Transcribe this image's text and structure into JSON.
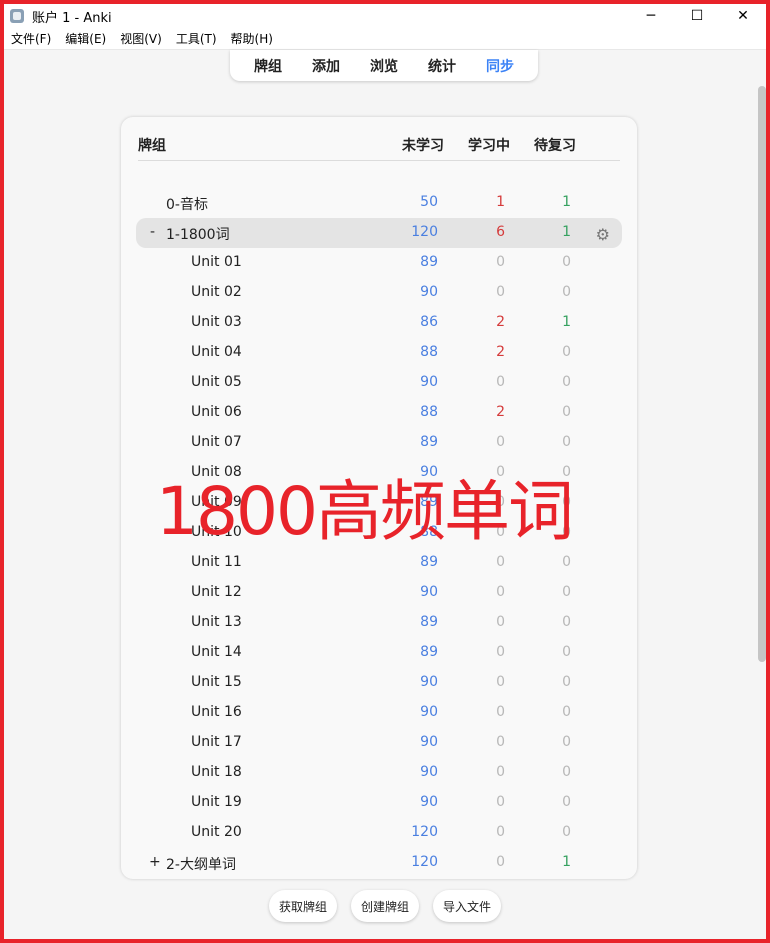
{
  "window": {
    "title": "账户 1 - Anki",
    "minimize": "─",
    "maximize": "☐",
    "close": "✕"
  },
  "menu": [
    "文件(F)",
    "编辑(E)",
    "视图(V)",
    "工具(T)",
    "帮助(H)"
  ],
  "toolbar": {
    "tabs": [
      "牌组",
      "添加",
      "浏览",
      "统计",
      "同步"
    ],
    "active": "同步"
  },
  "table": {
    "headers": {
      "deck": "牌组",
      "new": "未学习",
      "learn": "学习中",
      "review": "待复习"
    },
    "rows": [
      {
        "prefix": "",
        "name": "0-音标",
        "new": "50",
        "learn": "1",
        "review": "1",
        "indent": 0
      },
      {
        "prefix": "-",
        "name": "1-1800词",
        "new": "120",
        "learn": "6",
        "review": "1",
        "indent": 0,
        "current": true
      },
      {
        "prefix": "",
        "name": "Unit 01",
        "new": "89",
        "learn": "0",
        "review": "0",
        "indent": 1
      },
      {
        "prefix": "",
        "name": "Unit 02",
        "new": "90",
        "learn": "0",
        "review": "0",
        "indent": 1
      },
      {
        "prefix": "",
        "name": "Unit 03",
        "new": "86",
        "learn": "2",
        "review": "1",
        "indent": 1
      },
      {
        "prefix": "",
        "name": "Unit 04",
        "new": "88",
        "learn": "2",
        "review": "0",
        "indent": 1
      },
      {
        "prefix": "",
        "name": "Unit 05",
        "new": "90",
        "learn": "0",
        "review": "0",
        "indent": 1
      },
      {
        "prefix": "",
        "name": "Unit 06",
        "new": "88",
        "learn": "2",
        "review": "0",
        "indent": 1
      },
      {
        "prefix": "",
        "name": "Unit 07",
        "new": "89",
        "learn": "0",
        "review": "0",
        "indent": 1
      },
      {
        "prefix": "",
        "name": "Unit 08",
        "new": "90",
        "learn": "0",
        "review": "0",
        "indent": 1
      },
      {
        "prefix": "",
        "name": "Unit 09",
        "new": "89",
        "learn": "0",
        "review": "0",
        "indent": 1
      },
      {
        "prefix": "",
        "name": "Unit 10",
        "new": "88",
        "learn": "0",
        "review": "0",
        "indent": 1
      },
      {
        "prefix": "",
        "name": "Unit 11",
        "new": "89",
        "learn": "0",
        "review": "0",
        "indent": 1
      },
      {
        "prefix": "",
        "name": "Unit 12",
        "new": "90",
        "learn": "0",
        "review": "0",
        "indent": 1
      },
      {
        "prefix": "",
        "name": "Unit 13",
        "new": "89",
        "learn": "0",
        "review": "0",
        "indent": 1
      },
      {
        "prefix": "",
        "name": "Unit 14",
        "new": "89",
        "learn": "0",
        "review": "0",
        "indent": 1
      },
      {
        "prefix": "",
        "name": "Unit 15",
        "new": "90",
        "learn": "0",
        "review": "0",
        "indent": 1
      },
      {
        "prefix": "",
        "name": "Unit 16",
        "new": "90",
        "learn": "0",
        "review": "0",
        "indent": 1
      },
      {
        "prefix": "",
        "name": "Unit 17",
        "new": "90",
        "learn": "0",
        "review": "0",
        "indent": 1
      },
      {
        "prefix": "",
        "name": "Unit 18",
        "new": "90",
        "learn": "0",
        "review": "0",
        "indent": 1
      },
      {
        "prefix": "",
        "name": "Unit 19",
        "new": "90",
        "learn": "0",
        "review": "0",
        "indent": 1
      },
      {
        "prefix": "",
        "name": "Unit 20",
        "new": "120",
        "learn": "0",
        "review": "0",
        "indent": 1
      },
      {
        "prefix": "+",
        "name": "2-大纲单词",
        "new": "120",
        "learn": "0",
        "review": "1",
        "indent": 0
      }
    ]
  },
  "overlay": {
    "text": "1800高频单词"
  },
  "bottom_buttons": [
    "获取牌组",
    "创建牌组",
    "导入文件"
  ],
  "colors": {
    "new": "#4a7fe0",
    "learn": "#d53b3b",
    "review": "#36a160",
    "zero": "#b8b8b8",
    "accent": "#3b82f6",
    "frame": "#e8232a"
  },
  "icons": {
    "gear": "gear-icon"
  }
}
